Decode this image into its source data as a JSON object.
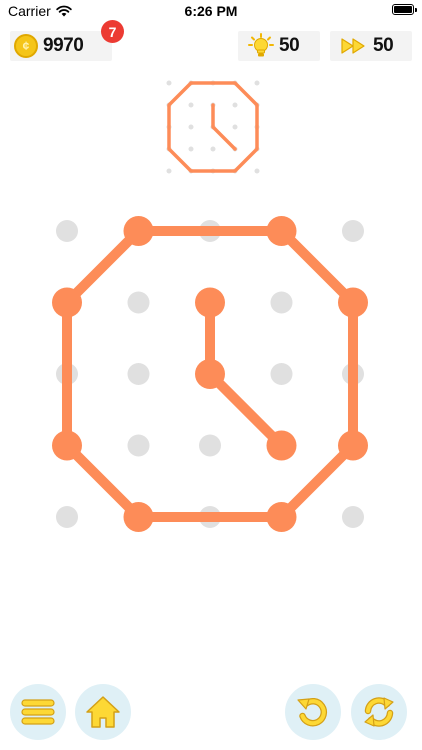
{
  "status_bar": {
    "carrier": "Carrier",
    "time": "6:26 PM"
  },
  "top_bar": {
    "coins": "9970",
    "notification_count": "7",
    "hints": "50",
    "skips": "50"
  },
  "colors": {
    "accent": "#fd8c58",
    "dot": "#e0e0e0",
    "button_bg": "#dff0f6",
    "icon_yellow": "#fdd835",
    "badge": "#ec3b33"
  },
  "icons": {
    "menu": "hamburger-menu-icon",
    "home": "home-icon",
    "undo": "undo-icon",
    "restart": "restart-icon",
    "hint": "lightbulb-icon",
    "skip": "fast-forward-icon",
    "coin": "coin-icon"
  },
  "grid": {
    "columns": 5,
    "rows": 5
  },
  "puzzle": {
    "name": "clock",
    "outline_path": [
      [
        1,
        0
      ],
      [
        3,
        0
      ],
      [
        4,
        1
      ],
      [
        4,
        3
      ],
      [
        3,
        4
      ],
      [
        1,
        4
      ],
      [
        0,
        3
      ],
      [
        0,
        1
      ],
      [
        1,
        0
      ]
    ],
    "hand_path": [
      [
        2,
        1
      ],
      [
        2,
        2
      ],
      [
        3,
        3
      ]
    ]
  }
}
